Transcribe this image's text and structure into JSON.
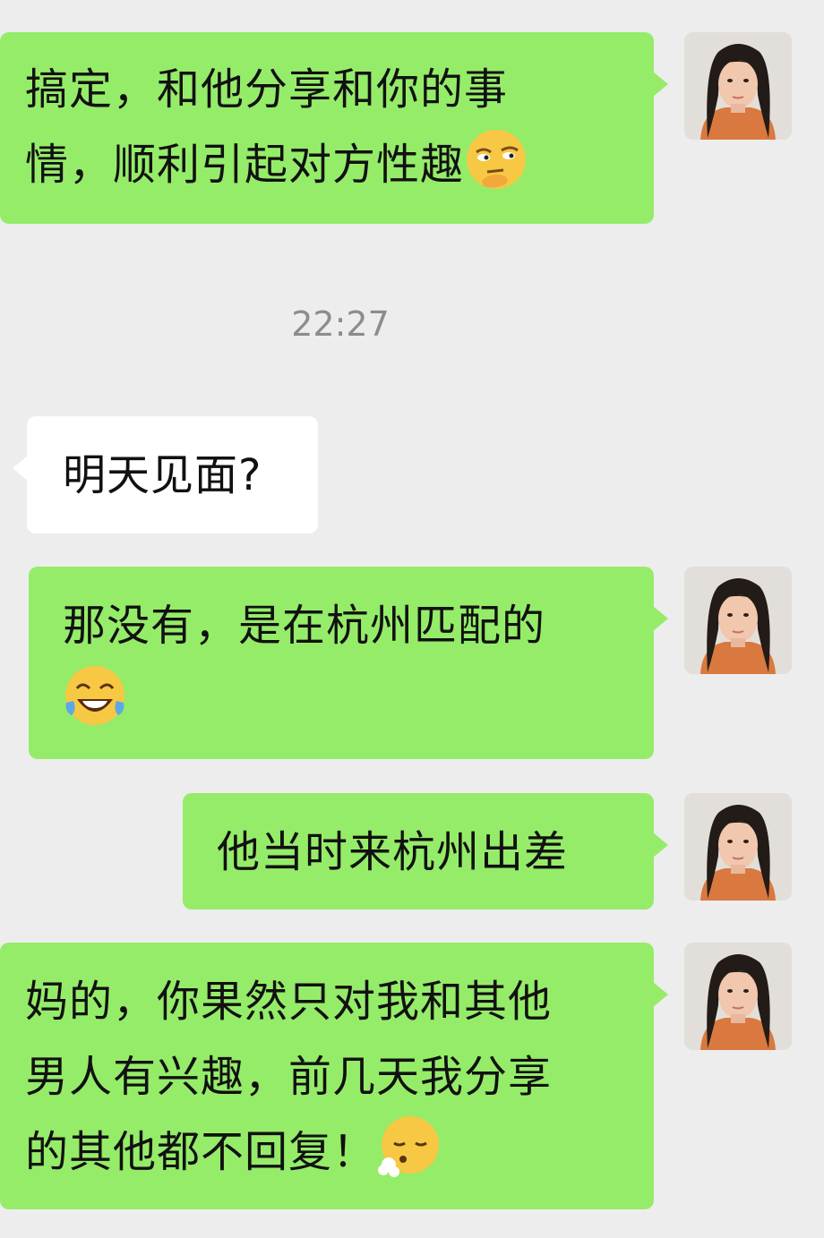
{
  "chat": {
    "messages": [
      {
        "side": "right",
        "lines": [
          "搞定，和他分享和你的事",
          "情，顺利引起对方性趣"
        ],
        "emoji": "smirk-emoji"
      },
      {
        "time": "22:27"
      },
      {
        "side": "left",
        "lines": [
          "明天见面?"
        ]
      },
      {
        "side": "right",
        "lines": [
          "那没有，是在杭州匹配的"
        ],
        "emoji": "tears-of-joy-emoji"
      },
      {
        "side": "right",
        "lines": [
          "他当时来杭州出差"
        ]
      },
      {
        "side": "right",
        "lines": [
          "妈的，你果然只对我和其他",
          "男人有兴趣，前几天我分享",
          "的其他都不回复！"
        ],
        "emoji": "exhaling-face-emoji"
      }
    ]
  },
  "colors": {
    "my_bubble": "#95ec69",
    "their_bubble": "#ffffff",
    "background": "#ededed",
    "timestamp": "#8c8c8c"
  }
}
